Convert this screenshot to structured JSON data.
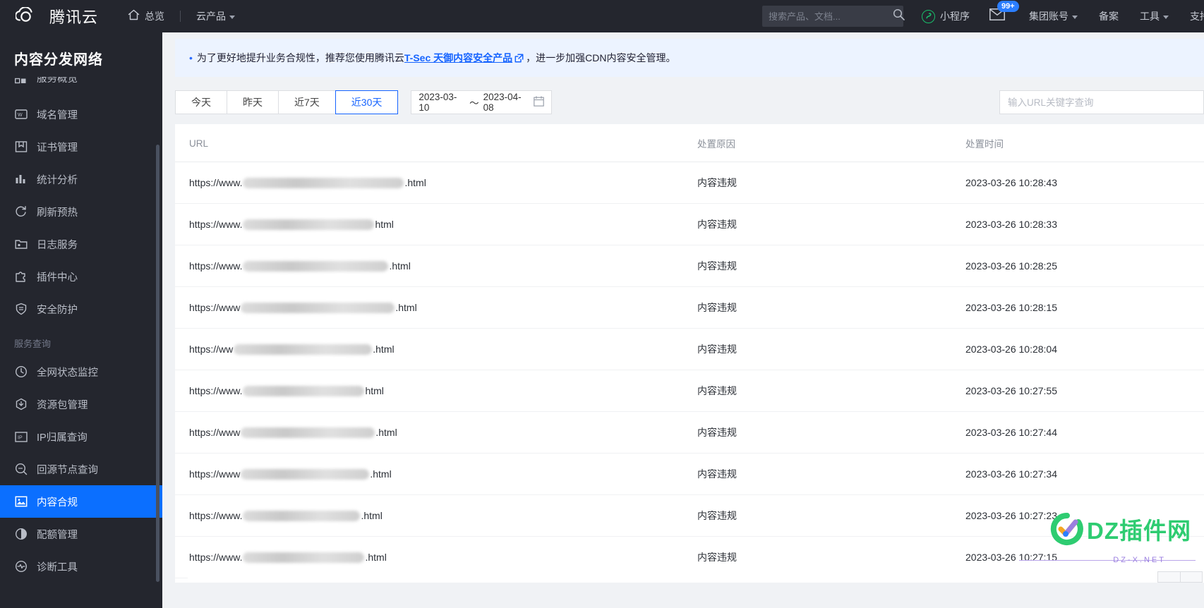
{
  "header": {
    "logo_text": "腾讯云",
    "home_label": "总览",
    "products_label": "云产品",
    "search_placeholder": "搜索产品、文档...",
    "search_value": "",
    "mini_program_label": "小程序",
    "mail_badge": "99+",
    "group_account_label": "集团账号",
    "beian_label": "备案",
    "tools_label": "工具",
    "support_label": "支持"
  },
  "sidebar": {
    "title": "内容分发网络",
    "items": [
      {
        "label": "服务概览",
        "icon": "dashboard-icon",
        "arrow": false,
        "active": false,
        "clipped": true
      },
      {
        "label": "域名管理",
        "icon": "domain-icon",
        "arrow": false,
        "active": false
      },
      {
        "label": "证书管理",
        "icon": "certificate-icon",
        "arrow": true,
        "active": false
      },
      {
        "label": "统计分析",
        "icon": "bar-chart-icon",
        "arrow": true,
        "active": false
      },
      {
        "label": "刷新预热",
        "icon": "refresh-icon",
        "arrow": false,
        "active": false
      },
      {
        "label": "日志服务",
        "icon": "log-folder-icon",
        "arrow": false,
        "active": false
      },
      {
        "label": "插件中心",
        "icon": "plugin-icon",
        "arrow": false,
        "active": false
      },
      {
        "label": "安全防护",
        "icon": "shield-icon",
        "arrow": true,
        "active": false
      }
    ],
    "group_label": "服务查询",
    "group_items": [
      {
        "label": "全网状态监控",
        "icon": "gauge-icon",
        "arrow": false,
        "active": false
      },
      {
        "label": "资源包管理",
        "icon": "package-icon",
        "arrow": false,
        "active": false
      },
      {
        "label": "IP归属查询",
        "icon": "ip-icon",
        "arrow": false,
        "active": false
      },
      {
        "label": "回源节点查询",
        "icon": "origin-search-icon",
        "arrow": false,
        "active": false
      },
      {
        "label": "内容合规",
        "icon": "image-compliance-icon",
        "arrow": false,
        "active": true
      },
      {
        "label": "配额管理",
        "icon": "quota-pie-icon",
        "arrow": true,
        "active": false
      },
      {
        "label": "诊断工具",
        "icon": "diagnostic-icon",
        "arrow": false,
        "active": false
      }
    ]
  },
  "notice": {
    "prefix": "为了更好地提升业务合规性，推荐您使用腾讯云",
    "link": "T-Sec 天御内容安全产品",
    "suffix": "，进一步加强CDN内容安全管理。"
  },
  "filters": {
    "range_tabs": [
      {
        "label": "今天",
        "active": false
      },
      {
        "label": "昨天",
        "active": false
      },
      {
        "label": "近7天",
        "active": false
      },
      {
        "label": "近30天",
        "active": true
      }
    ],
    "date_start": "2023-03-10",
    "date_separator": "～",
    "date_end": "2023-04-08",
    "url_search_placeholder": "输入URL关键字查询",
    "url_search_value": ""
  },
  "table": {
    "columns": [
      "URL",
      "处置原因",
      "处置时间"
    ],
    "rows": [
      {
        "url_prefix": "https://www.",
        "url_mask_width": 228,
        "url_suffix": ".html",
        "reason": "内容违规",
        "time": "2023-03-26 10:28:43"
      },
      {
        "url_prefix": "https://www.",
        "url_mask_width": 186,
        "url_suffix": "html",
        "reason": "内容违规",
        "time": "2023-03-26 10:28:33"
      },
      {
        "url_prefix": "https://www.",
        "url_mask_width": 206,
        "url_suffix": ".html",
        "reason": "内容违规",
        "time": "2023-03-26 10:28:25"
      },
      {
        "url_prefix": "https://www",
        "url_mask_width": 218,
        "url_suffix": ".html",
        "reason": "内容违规",
        "time": "2023-03-26 10:28:15"
      },
      {
        "url_prefix": "https://ww",
        "url_mask_width": 196,
        "url_suffix": ".html",
        "reason": "内容违规",
        "time": "2023-03-26 10:28:04"
      },
      {
        "url_prefix": "https://www.",
        "url_mask_width": 172,
        "url_suffix": "html",
        "reason": "内容违规",
        "time": "2023-03-26 10:27:55"
      },
      {
        "url_prefix": "https://www",
        "url_mask_width": 190,
        "url_suffix": ".html",
        "reason": "内容违规",
        "time": "2023-03-26 10:27:44"
      },
      {
        "url_prefix": "https://www",
        "url_mask_width": 182,
        "url_suffix": ".html",
        "reason": "内容违规",
        "time": "2023-03-26 10:27:34"
      },
      {
        "url_prefix": "https://www.",
        "url_mask_width": 166,
        "url_suffix": ".html",
        "reason": "内容违规",
        "time": "2023-03-26 10:27:23"
      },
      {
        "url_prefix": "https://www.",
        "url_mask_width": 172,
        "url_suffix": ".html",
        "reason": "内容违规",
        "time": "2023-03-26 10:27:15"
      }
    ]
  },
  "watermark": {
    "text": "DZ插件网",
    "subtext": "DZ-X.NET"
  },
  "colors": {
    "header_bg": "#24262e",
    "accent": "#1664ff",
    "active_nav": "#0b6fff",
    "notice_bg": "#ecf3ff",
    "watermark_green": "#2ecc71"
  }
}
